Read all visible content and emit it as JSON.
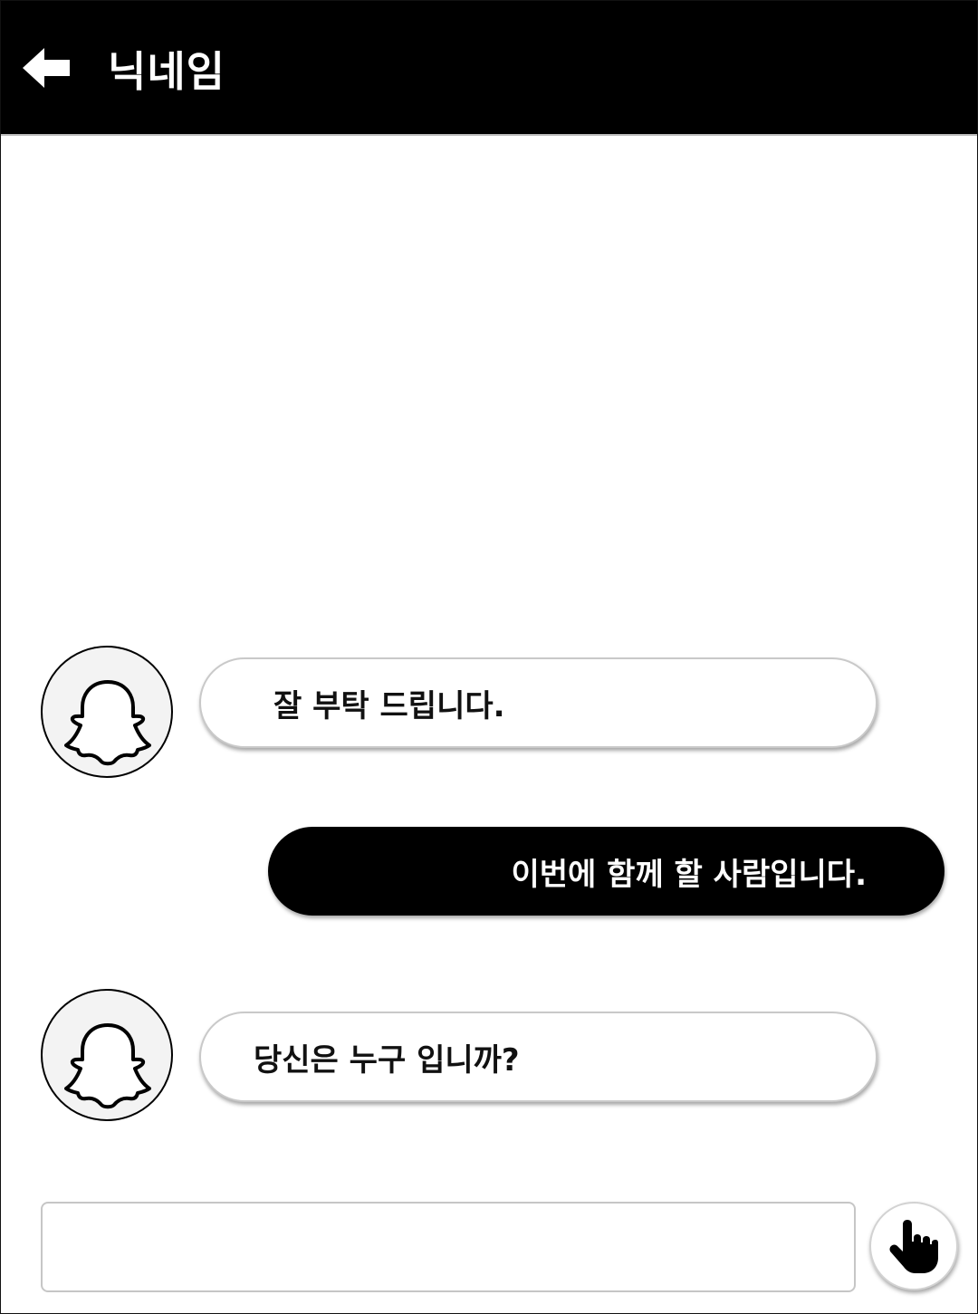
{
  "header": {
    "title": "닉네임",
    "back_icon": "back-arrow-icon"
  },
  "messages": [
    {
      "direction": "incoming",
      "text": "잘 부탁 드립니다.",
      "avatar_icon": "ghost-icon"
    },
    {
      "direction": "outgoing",
      "text": "이번에 함께 할 사람입니다."
    },
    {
      "direction": "incoming",
      "text": "당신은 누구 입니까?",
      "avatar_icon": "ghost-icon"
    }
  ],
  "composer": {
    "value": "",
    "placeholder": "",
    "send_icon": "pointing-hand-icon"
  },
  "colors": {
    "header_bg": "#000000",
    "outgoing_bubble_bg": "#000000",
    "incoming_bubble_bg": "#ffffff"
  }
}
